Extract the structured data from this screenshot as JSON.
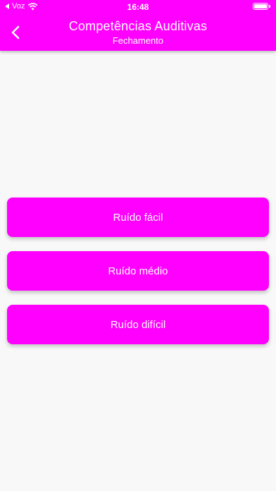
{
  "status_bar": {
    "carrier": "Voz",
    "time": "16:48",
    "battery_level": 1.0
  },
  "header": {
    "title": "Competências Auditivas",
    "subtitle": "Fechamento",
    "back_icon": "chevron-left-icon"
  },
  "buttons": [
    {
      "label": "Ruído fácil"
    },
    {
      "label": "Ruído médio"
    },
    {
      "label": "Ruído difícil"
    }
  ],
  "colors": {
    "accent": "#ff00ff",
    "background": "#f8f8f8",
    "text_on_accent": "#ffffff"
  }
}
